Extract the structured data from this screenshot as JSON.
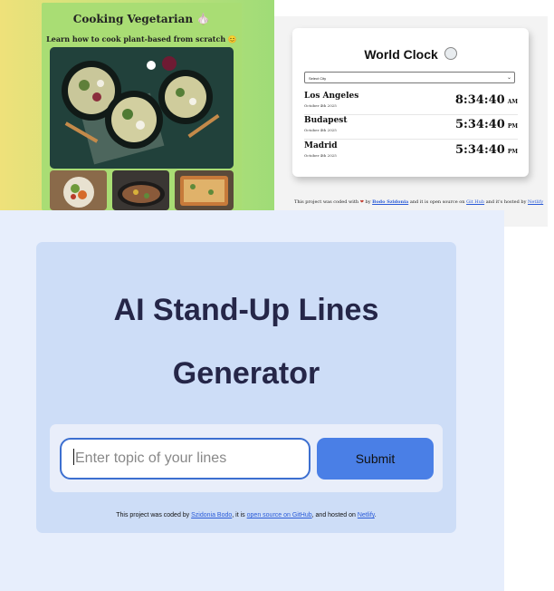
{
  "cooking": {
    "title": "Cooking Vegetarian 🧄",
    "subtitle": "Learn how to cook plant-based from scratch 😊"
  },
  "world_clock": {
    "title": "World Clock",
    "select_value": "Select City",
    "cities": [
      {
        "name": "Los Angeles",
        "date": "October 4th 2025",
        "time": "8:34:40",
        "ampm": "AM"
      },
      {
        "name": "Budapest",
        "date": "October 4th 2025",
        "time": "5:34:40",
        "ampm": "PM"
      },
      {
        "name": "Madrid",
        "date": "October 4th 2025",
        "time": "5:34:40",
        "ampm": "PM"
      }
    ],
    "footer": {
      "part1": "This project was coded with",
      "heart": "❤",
      "by": "by",
      "author": "Bodo Szidonia",
      "part2": "and it is open source on",
      "repo": "Git Hub",
      "part3": "and it's hosted by",
      "host": "Netlify"
    }
  },
  "standup": {
    "title_line1": "AI Stand-Up Lines",
    "title_line2": "Generator",
    "input_placeholder": "Enter topic of your lines",
    "submit_label": "Submit",
    "footer": {
      "part1": "This project was coded by",
      "author": "Szidonia Bodo",
      "part2": ", it is",
      "repo": "open source on GitHub",
      "part3": ", and hosted on",
      "host": "Netlify",
      "part4": "."
    }
  }
}
